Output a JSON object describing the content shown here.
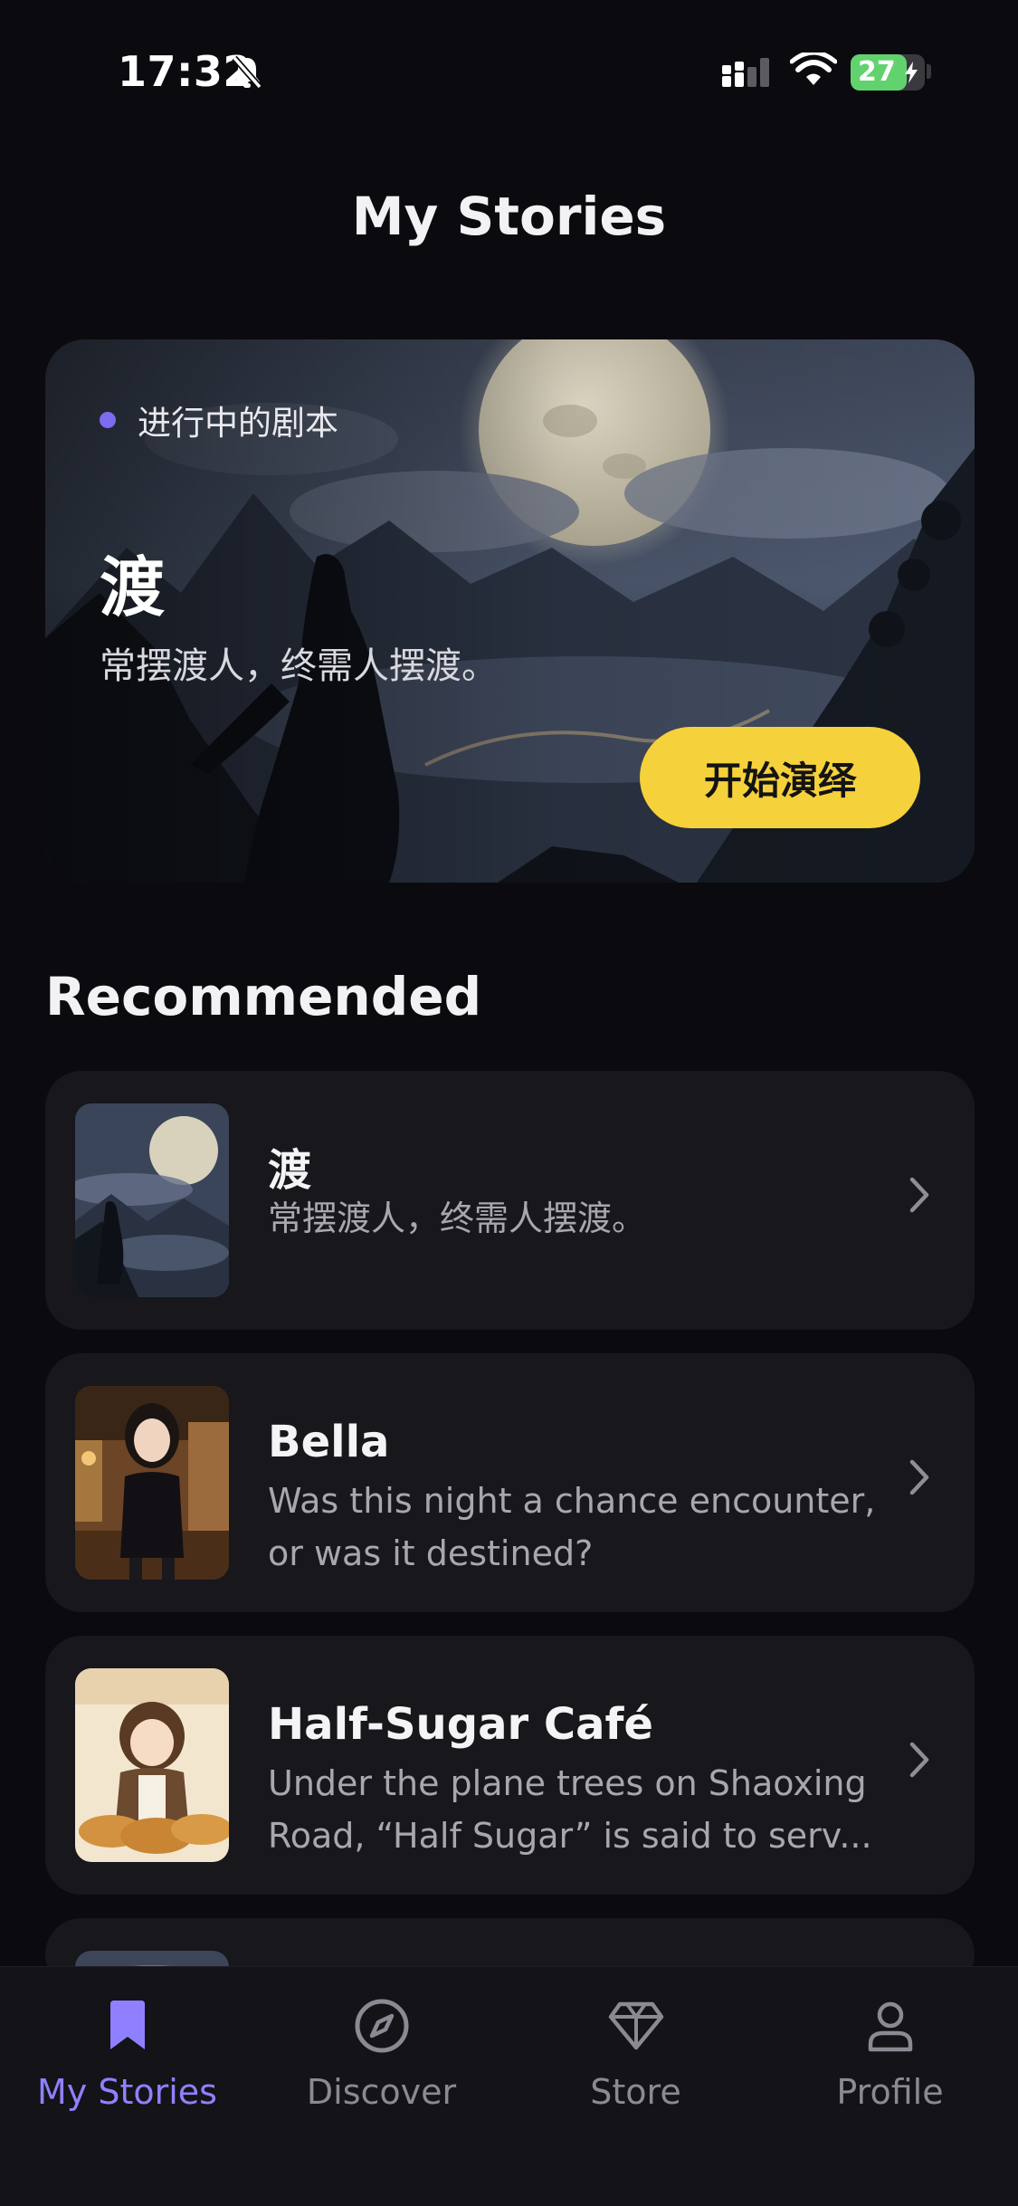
{
  "status_bar": {
    "time": "17:32",
    "battery": "27",
    "battery_level": 0.27
  },
  "header": {
    "title": "My Stories"
  },
  "hero": {
    "tag": "进行中的剧本",
    "title": "渡",
    "subtitle": "常摆渡人，终需人摆渡。",
    "button_label": "开始演绎"
  },
  "recommended": {
    "title": "Recommended",
    "items": [
      {
        "title": "渡",
        "desc": "常摆渡人，终需人摆渡。"
      },
      {
        "title": "Bella",
        "desc": "Was this night a chance encounter, or was it destined?"
      },
      {
        "title": "Half-Sugar Café",
        "desc": "Under the plane trees on Shaoxing Road, “Half Sugar” is said to serv..."
      }
    ]
  },
  "tabs": [
    {
      "label": "My Stories",
      "icon": "bookmark-icon",
      "active": true
    },
    {
      "label": "Discover",
      "icon": "compass-icon",
      "active": false
    },
    {
      "label": "Store",
      "icon": "diamond-icon",
      "active": false
    },
    {
      "label": "Profile",
      "icon": "person-icon",
      "active": false
    }
  ],
  "colors": {
    "accent": "#8f80ff",
    "button": "#f5d13c",
    "background": "#0b0b0f",
    "card": "#17171c"
  }
}
